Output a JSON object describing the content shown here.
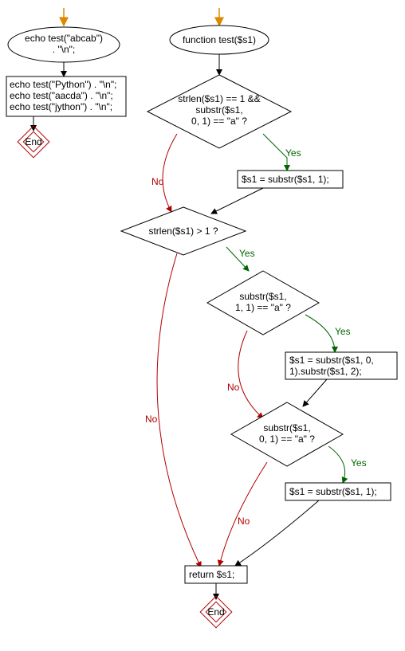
{
  "chart_data": {
    "type": "flowchart",
    "swimlanes": [
      "main",
      "function"
    ],
    "nodes": [
      {
        "id": "n_start_main",
        "lane": "main",
        "shape": "ellipse",
        "label1": "echo test(\"abcab\")",
        "label2": ". \"\\n\";"
      },
      {
        "id": "n_proc_main",
        "lane": "main",
        "shape": "process",
        "lines": [
          "echo test(\"Python\") . \"\\n\";",
          "echo test(\"aacda\") . \"\\n\";",
          "echo test(\"jython\") . \"\\n\";"
        ]
      },
      {
        "id": "n_end_main",
        "lane": "main",
        "shape": "end",
        "label": "End"
      },
      {
        "id": "n_func",
        "lane": "function",
        "shape": "ellipse",
        "label": "function test($s1)"
      },
      {
        "id": "n_d1",
        "lane": "function",
        "shape": "decision",
        "lines": [
          "strlen($s1) == 1 &&",
          "substr($s1,",
          "0, 1) == \"a\" ?"
        ]
      },
      {
        "id": "n_p1",
        "lane": "function",
        "shape": "process",
        "label": "$s1 = substr($s1, 1);"
      },
      {
        "id": "n_d2",
        "lane": "function",
        "shape": "decision",
        "label": "strlen($s1) > 1 ?"
      },
      {
        "id": "n_d3",
        "lane": "function",
        "shape": "decision",
        "lines": [
          "substr($s1,",
          "1, 1) == \"a\" ?"
        ]
      },
      {
        "id": "n_p2",
        "lane": "function",
        "shape": "process",
        "lines": [
          "$s1 = substr($s1, 0,",
          "1).substr($s1, 2);"
        ]
      },
      {
        "id": "n_d4",
        "lane": "function",
        "shape": "decision",
        "lines": [
          "substr($s1,",
          "0, 1) == \"a\" ?"
        ]
      },
      {
        "id": "n_p3",
        "lane": "function",
        "shape": "process",
        "label": "$s1 = substr($s1, 1);"
      },
      {
        "id": "n_ret",
        "lane": "function",
        "shape": "process",
        "label": "return $s1;"
      },
      {
        "id": "n_end_f",
        "lane": "function",
        "shape": "end",
        "label": "End"
      }
    ],
    "edges": [
      {
        "from": "entry_main",
        "to": "n_start_main",
        "color": "#dd8800"
      },
      {
        "from": "n_start_main",
        "to": "n_proc_main",
        "color": "#000000"
      },
      {
        "from": "n_proc_main",
        "to": "n_end_main",
        "color": "#000000"
      },
      {
        "from": "entry_func",
        "to": "n_func",
        "color": "#dd8800"
      },
      {
        "from": "n_func",
        "to": "n_d1",
        "color": "#000000"
      },
      {
        "from": "n_d1",
        "to": "n_p1",
        "label": "Yes",
        "color": "#006400"
      },
      {
        "from": "n_d1",
        "to": "n_d2",
        "label": "No",
        "color": "#b00000"
      },
      {
        "from": "n_p1",
        "to": "n_d2",
        "color": "#000000"
      },
      {
        "from": "n_d2",
        "to": "n_d3",
        "label": "Yes",
        "color": "#006400"
      },
      {
        "from": "n_d2",
        "to": "n_ret",
        "label": "No",
        "color": "#b00000"
      },
      {
        "from": "n_d3",
        "to": "n_p2",
        "label": "Yes",
        "color": "#006400"
      },
      {
        "from": "n_d3",
        "to": "n_d4",
        "label": "No",
        "color": "#b00000"
      },
      {
        "from": "n_p2",
        "to": "n_d4",
        "color": "#000000"
      },
      {
        "from": "n_d4",
        "to": "n_p3",
        "label": "Yes",
        "color": "#006400"
      },
      {
        "from": "n_d4",
        "to": "n_ret",
        "label": "No",
        "color": "#b00000"
      },
      {
        "from": "n_p3",
        "to": "n_ret",
        "color": "#000000"
      },
      {
        "from": "n_ret",
        "to": "n_end_f",
        "color": "#000000"
      }
    ]
  },
  "labels": {
    "yes": "Yes",
    "no": "No",
    "end": "End"
  },
  "text": {
    "start_main_l1": "echo test(\"abcab\")",
    "start_main_l2": ". \"\\n\";",
    "proc_main_l1": "echo test(\"Python\") . \"\\n\";",
    "proc_main_l2": "echo test(\"aacda\") . \"\\n\";",
    "proc_main_l3": "echo test(\"jython\") . \"\\n\";",
    "func": "function test($s1)",
    "d1_l1": "strlen($s1) == 1 &&",
    "d1_l2": "substr($s1,",
    "d1_l3": "0, 1) == \"a\" ?",
    "p1": "$s1 = substr($s1, 1);",
    "d2": "strlen($s1) > 1 ?",
    "d3_l1": "substr($s1,",
    "d3_l2": "1, 1) == \"a\" ?",
    "p2_l1": "$s1 = substr($s1, 0,",
    "p2_l2": "1).substr($s1, 2);",
    "d4_l1": "substr($s1,",
    "d4_l2": "0, 1) == \"a\" ?",
    "p3": "$s1 = substr($s1, 1);",
    "ret": "return $s1;"
  }
}
